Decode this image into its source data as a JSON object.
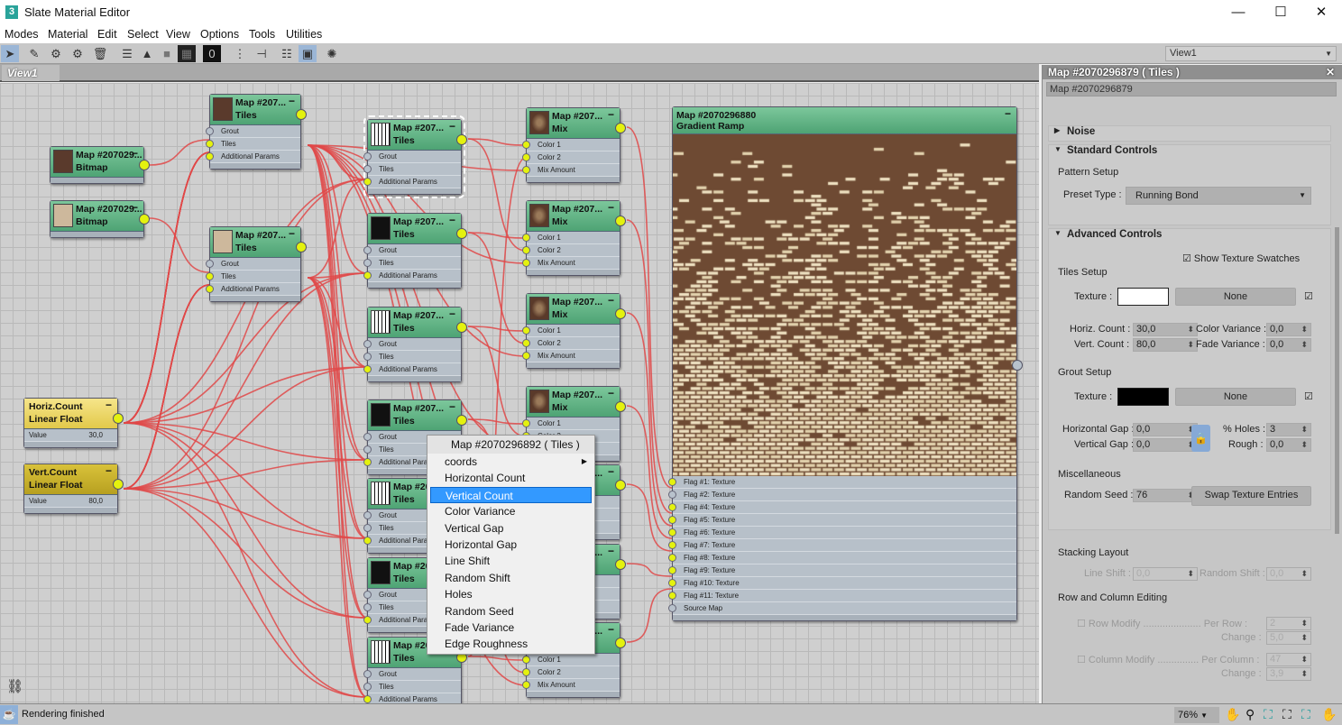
{
  "window": {
    "title": "Slate Material Editor",
    "app_icon": "3",
    "minimize": "—",
    "maximize": "☐",
    "close": "✕"
  },
  "menu": [
    "Modes",
    "Material",
    "Edit",
    "Select",
    "View",
    "Options",
    "Tools",
    "Utilities"
  ],
  "toolbar": {
    "view_select": "View1",
    "icons": [
      "select-arrow",
      "eyedropper",
      "put-to-scene",
      "assign-to-selection",
      "delete",
      "move-children",
      "hide-unused-slots",
      "show-shaded",
      "show-background",
      "material-id",
      "layout-all",
      "layout-children",
      "show-params",
      "show-map-in-viewport",
      "material-explorer"
    ],
    "material_id": "0"
  },
  "view": {
    "tab": "View1"
  },
  "nodes": {
    "bitmap1": {
      "title": "Map #207029...",
      "type": "Bitmap",
      "swatch": "#5a3a2c"
    },
    "bitmap2": {
      "title": "Map #207029...",
      "type": "Bitmap",
      "swatch": "#cdb89c"
    },
    "tilesA": {
      "title": "Map #207...",
      "type": "Tiles",
      "swatch": "#5a3a2c",
      "rows": [
        "Grout",
        "Tiles",
        "Additional Params"
      ]
    },
    "tilesB": {
      "title": "Map #207...",
      "type": "Tiles",
      "swatch": "#cdb89c",
      "rows": [
        "Grout",
        "Tiles",
        "Additional Params"
      ]
    },
    "tilesC": {
      "title": "Map #207...",
      "type": "Tiles",
      "rows": [
        "Grout",
        "Tiles",
        "Additional Params"
      ]
    },
    "mix": {
      "title": "Map #207...",
      "type": "Mix",
      "rows": [
        "Color 1",
        "Color 2",
        "Mix Amount"
      ]
    },
    "ramp": {
      "title": "Map #2070296880",
      "type": "Gradient Ramp",
      "rows": [
        "Flag #1: Texture",
        "Flag #2: Texture",
        "Flag #4: Texture",
        "Flag #5: Texture",
        "Flag #6: Texture",
        "Flag #7: Texture",
        "Flag #8: Texture",
        "Flag #9: Texture",
        "Flag #10: Texture",
        "Flag #11: Texture",
        "Source Map"
      ]
    },
    "horiz": {
      "title": "Horiz.Count",
      "type": "Linear Float",
      "row": "Value",
      "value": "30,0"
    },
    "vert": {
      "title": "Vert.Count",
      "type": "Linear Float",
      "row": "Value",
      "value": "80,0"
    }
  },
  "context_menu": {
    "header": "Map #2070296892  ( Tiles )",
    "items": [
      "coords",
      "Horizontal Count",
      "Vertical Count",
      "Color Variance",
      "Vertical Gap",
      "Horizontal Gap",
      "Line Shift",
      "Random Shift",
      "Holes",
      "Random Seed",
      "Fade Variance",
      "Edge Roughness"
    ],
    "highlighted": "Vertical Count"
  },
  "panel": {
    "header": "Map #2070296879  ( Tiles )",
    "name": "Map #2070296879",
    "noise": "Noise",
    "standard": "Standard Controls",
    "pattern_setup": "Pattern Setup",
    "preset_label": "Preset Type :",
    "preset_value": "Running Bond",
    "advanced": "Advanced Controls",
    "show_swatches": "Show Texture Swatches",
    "tiles_setup": "Tiles Setup",
    "texture_label": "Texture :",
    "none": "None",
    "tiles_color": "#ffffff",
    "horiz_label": "Horiz. Count :",
    "horiz": "30,0",
    "vert_label": "Vert. Count :",
    "vert": "80,0",
    "colvar_label": "Color Variance :",
    "colvar": "0,0",
    "fadevar_label": "Fade Variance :",
    "fadevar": "0,0",
    "grout_setup": "Grout Setup",
    "grout_color": "#000000",
    "hgap_label": "Horizontal Gap :",
    "hgap": "0,0",
    "vgap_label": "Vertical Gap :",
    "vgap": "0,0",
    "holes_label": "% Holes :",
    "holes": "3",
    "rough_label": "Rough :",
    "rough": "0,0",
    "misc": "Miscellaneous",
    "seed_label": "Random Seed :",
    "seed": "76",
    "swap": "Swap Texture Entries",
    "stacking": "Stacking Layout",
    "lineshift_label": "Line Shift :",
    "lineshift": "0,0",
    "randshift_label": "Random Shift :",
    "randshift": "0,0",
    "rowcol": "Row and Column Editing",
    "rowmod": "Row Modify",
    "perrow_label": "Per Row :",
    "perrow": "2",
    "change_label": "Change :",
    "rowchange": "5,0",
    "colmod": "Column Modify",
    "percol_label": "Per Column :",
    "percol": "47",
    "colchange": "3,9",
    "dots": "....................."
  },
  "status": {
    "text": "Rendering finished",
    "zoom": "76%"
  },
  "colors": {
    "wire": "#e04848",
    "node_header": "#5cb083",
    "socket_active": "#e4f20e",
    "highlight": "#3399ff"
  }
}
